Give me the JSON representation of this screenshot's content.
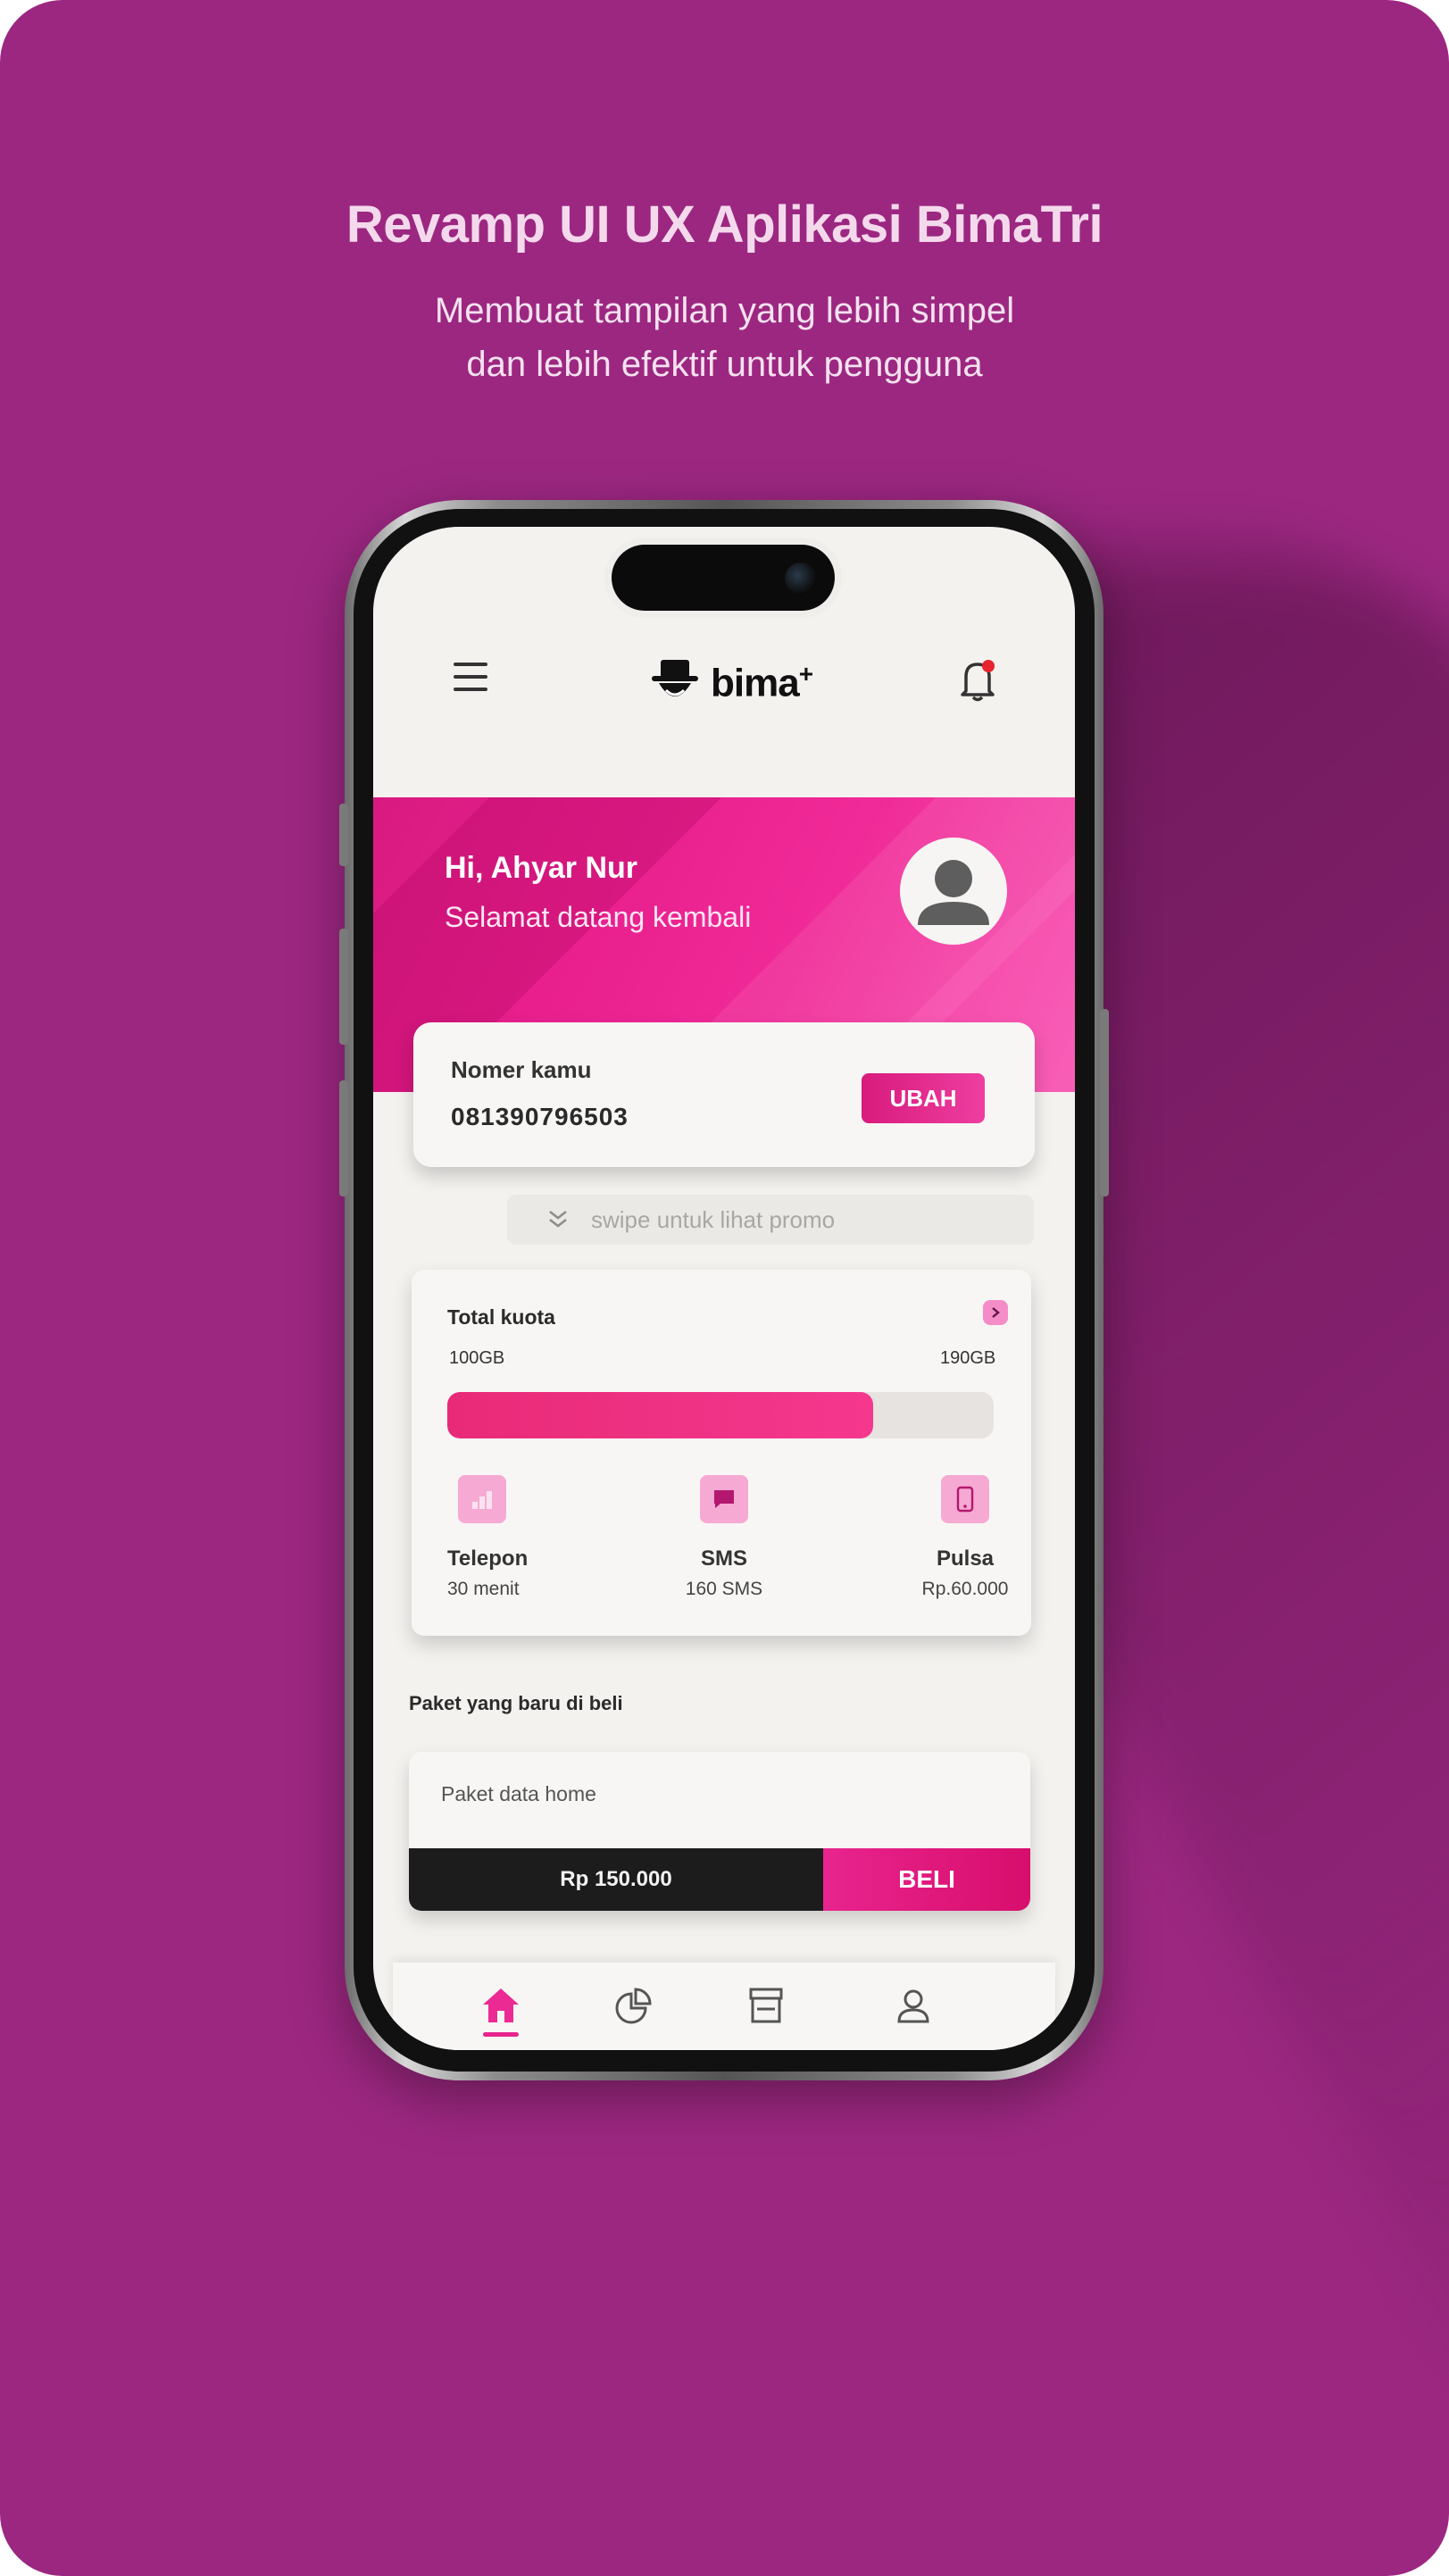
{
  "headline": "Revamp UI UX Aplikasi BimaTri",
  "subline": [
    "Membuat tampilan yang lebih simpel",
    "dan lebih efektif untuk pengguna"
  ],
  "app": {
    "logo_text": "bima",
    "logo_sup": "+",
    "icons": {
      "menu": "hamburger-icon",
      "bell": "bell-icon",
      "logo": "hat-mascot-icon"
    }
  },
  "hero": {
    "greeting": "Hi, Ahyar Nur",
    "welcome": "Selamat datang kembali"
  },
  "number_card": {
    "label": "Nomer kamu",
    "number": "081390796503",
    "change_button": "UBAH"
  },
  "swipe_hint": "swipe untuk lihat promo",
  "quota": {
    "title": "Total kuota",
    "used_label": "100GB",
    "total_label": "190GB",
    "used_fraction": 0.78,
    "items": [
      {
        "label": "Telepon",
        "value": "30 menit",
        "icon": "signal-bars-icon"
      },
      {
        "label": "SMS",
        "value": "160 SMS",
        "icon": "chat-bubble-icon"
      },
      {
        "label": "Pulsa",
        "value": "Rp.60.000",
        "icon": "phone-device-icon"
      }
    ]
  },
  "recent": {
    "title": "Paket yang baru di beli",
    "package_name": "Paket data home",
    "price": "Rp 150.000",
    "buy_button": "BELI"
  },
  "bottom_nav": [
    {
      "name": "home",
      "icon": "home-icon",
      "active": true
    },
    {
      "name": "stats",
      "icon": "pie-chart-icon",
      "active": false
    },
    {
      "name": "store",
      "icon": "store-icon",
      "active": false
    },
    {
      "name": "profile",
      "icon": "user-icon",
      "active": false
    }
  ],
  "colors": {
    "background": "#9c2781",
    "accent": "#e8248e",
    "dark": "#1c1c1c",
    "screen": "#f4f2ef"
  }
}
